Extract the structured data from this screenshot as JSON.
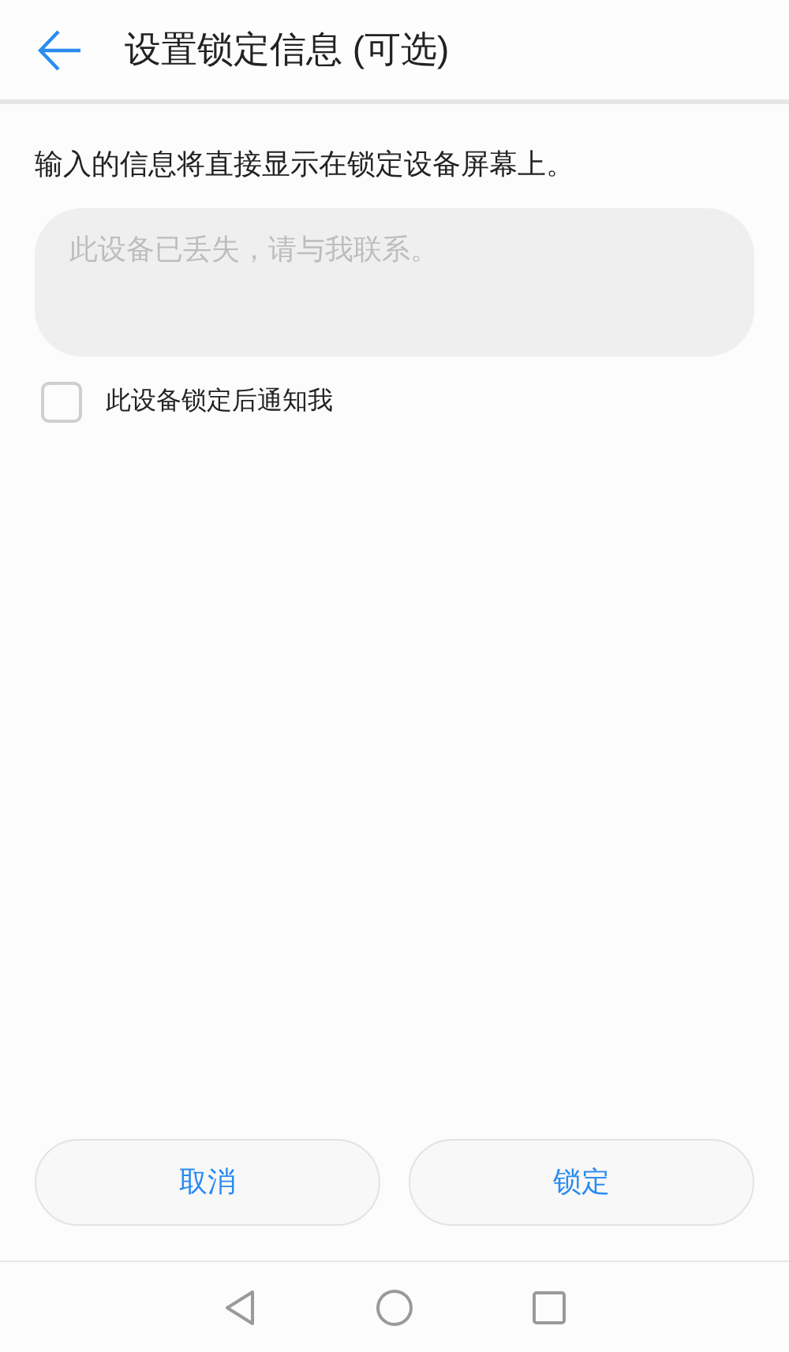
{
  "header": {
    "title": "设置锁定信息 (可选)"
  },
  "description": "输入的信息将直接显示在锁定设备屏幕上。",
  "message_field": {
    "placeholder": "此设备已丢失，请与我联系。"
  },
  "notify_option": {
    "label": "此设备锁定后通知我",
    "checked": false
  },
  "buttons": [
    {
      "label": "取消"
    },
    {
      "label": "锁定"
    }
  ]
}
